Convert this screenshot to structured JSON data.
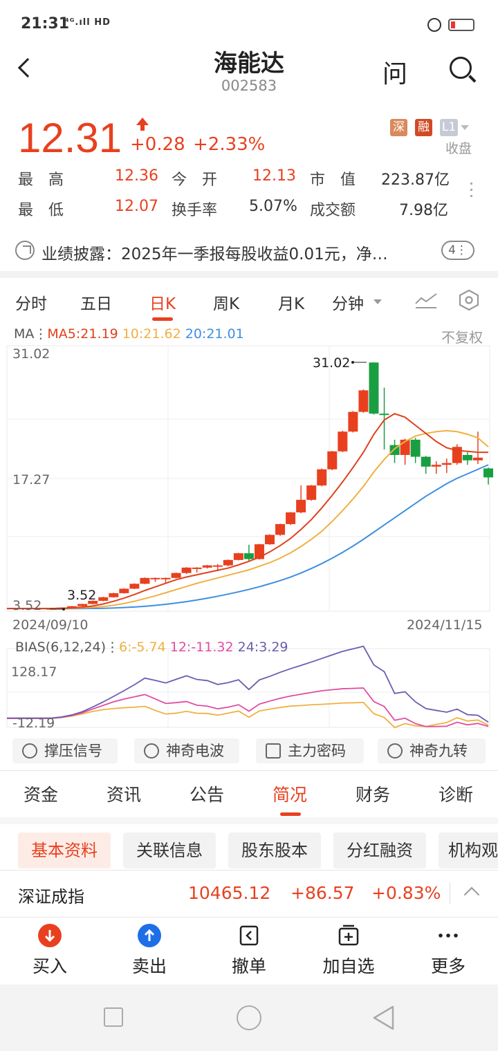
{
  "status": {
    "time": "21:31",
    "signal": "⁴ᴳ.ıll HD"
  },
  "header": {
    "title": "海能达",
    "code": "002583",
    "ask_label": "问"
  },
  "quote": {
    "price": "12.31",
    "change": "+0.28",
    "change_pct": "+2.33%",
    "tags": [
      "深",
      "融",
      "L1"
    ],
    "state": "收盘",
    "rows": [
      [
        {
          "label": "最　高",
          "value": "12.36"
        },
        {
          "label": "今　开",
          "value": "12.13"
        },
        {
          "label": "市　值",
          "value": "223.87亿"
        }
      ],
      [
        {
          "label": "最　低",
          "value": "12.07"
        },
        {
          "label": "换手率",
          "value": "5.07%"
        },
        {
          "label": "成交额",
          "value": "7.98亿"
        }
      ]
    ]
  },
  "notice": {
    "text": "业绩披露：2025年一季报每股收益0.01元，净…",
    "badge": "4⋮"
  },
  "chart_tabs": [
    "分时",
    "五日",
    "日K",
    "周K",
    "月K",
    "分钟"
  ],
  "ma_legend": {
    "prefix": "MA⋮",
    "ma5": "MA5:21.19",
    "ma10": "10:21.62",
    "ma20": "20:21.01",
    "right": "不复权"
  },
  "chart_labels": {
    "y_top": "31.02",
    "y_mid": "17.27",
    "y_bot": "3.52",
    "max_mark": "31.02",
    "min_mark": "3.52",
    "date_left": "2024/09/10",
    "date_right": "2024/11/15"
  },
  "bias_legend": {
    "prefix": "BIAS(6,12,24)⋮",
    "b6": "6:-5.74",
    "b12": "12:-11.32",
    "b24": "24:3.29",
    "y_top": "128.17",
    "y_bot": "-12.19"
  },
  "tools": [
    "撑压信号",
    "神奇电波",
    "主力密码",
    "神奇九转"
  ],
  "bottom_tabs": [
    "资金",
    "资讯",
    "公告",
    "简况",
    "财务",
    "诊断"
  ],
  "sub_tabs": [
    "基本资料",
    "关联信息",
    "股东股本",
    "分红融资",
    "机构观"
  ],
  "index": {
    "name": "深证成指",
    "value": "10465.12",
    "change": "+86.57",
    "pct": "+0.83%"
  },
  "actions": [
    "买入",
    "卖出",
    "撤单",
    "加自选",
    "更多"
  ],
  "colors": {
    "up": "#e8401f",
    "down": "#1a9e42",
    "ma5": "#e0401c",
    "ma10": "#f0b040",
    "ma20": "#3d8fe0",
    "bias6": "#f0b040",
    "bias12": "#e04ca0",
    "bias24": "#6c5cb0"
  },
  "chart_data": {
    "type": "candlestick",
    "y_range": [
      3.52,
      31.02
    ],
    "candles": [
      [
        3.6,
        3.62,
        3.58,
        3.64
      ],
      [
        3.62,
        3.7,
        3.6,
        3.72
      ],
      [
        3.7,
        3.85,
        3.68,
        3.88
      ],
      [
        3.85,
        4.1,
        3.82,
        4.12
      ],
      [
        4.1,
        4.45,
        4.05,
        4.5
      ],
      [
        4.45,
        4.85,
        4.4,
        4.9
      ],
      [
        4.85,
        5.3,
        4.8,
        5.35
      ],
      [
        5.3,
        5.8,
        5.25,
        5.85
      ],
      [
        5.8,
        6.35,
        5.75,
        6.4
      ],
      [
        6.35,
        7.0,
        6.3,
        7.05
      ],
      [
        7.0,
        7.0,
        6.55,
        7.05
      ],
      [
        7.0,
        7.0,
        6.45,
        7.05
      ],
      [
        7.0,
        7.55,
        6.95,
        7.6
      ],
      [
        7.55,
        8.15,
        7.45,
        8.2
      ],
      [
        8.15,
        8.15,
        7.6,
        8.2
      ],
      [
        8.15,
        8.4,
        8.05,
        8.45
      ],
      [
        8.4,
        8.4,
        7.75,
        8.55
      ],
      [
        8.4,
        9.0,
        8.3,
        9.05
      ],
      [
        9.0,
        9.75,
        8.95,
        9.8
      ],
      [
        9.75,
        9.1,
        8.85,
        10.7
      ],
      [
        9.1,
        10.75,
        9.05,
        10.8
      ],
      [
        10.75,
        11.8,
        10.7,
        11.85
      ],
      [
        11.8,
        13.0,
        11.7,
        13.05
      ],
      [
        13.0,
        14.3,
        12.9,
        14.35
      ],
      [
        14.3,
        15.7,
        14.2,
        17.3
      ],
      [
        15.7,
        17.3,
        15.6,
        17.35
      ],
      [
        17.3,
        19.1,
        17.2,
        19.2
      ],
      [
        19.1,
        21.1,
        19.0,
        21.15
      ],
      [
        21.1,
        23.3,
        21.0,
        23.4
      ],
      [
        23.3,
        25.5,
        23.2,
        25.6
      ],
      [
        25.5,
        27.9,
        25.4,
        28.0
      ],
      [
        31.0,
        25.3,
        25.2,
        31.02
      ],
      [
        25.3,
        25.2,
        21.3,
        28.2
      ],
      [
        21.8,
        20.7,
        19.8,
        22.4
      ],
      [
        20.7,
        22.4,
        19.6,
        22.5
      ],
      [
        22.4,
        20.5,
        19.8,
        22.6
      ],
      [
        20.5,
        19.4,
        18.6,
        20.6
      ],
      [
        19.4,
        19.6,
        18.6,
        20.0
      ],
      [
        19.6,
        19.8,
        18.7,
        20.3
      ],
      [
        19.8,
        21.6,
        19.6,
        21.9
      ],
      [
        20.7,
        20.1,
        19.6,
        21.0
      ],
      [
        20.1,
        20.4,
        19.7,
        23.3
      ],
      [
        19.2,
        18.2,
        17.4,
        19.3
      ]
    ],
    "ma5": [
      3.6,
      3.62,
      3.66,
      3.74,
      3.88,
      4.1,
      4.4,
      4.75,
      5.15,
      5.6,
      6.0,
      6.4,
      6.8,
      7.1,
      7.35,
      7.6,
      7.85,
      8.1,
      8.45,
      8.85,
      9.3,
      9.9,
      10.6,
      11.4,
      12.4,
      13.5,
      14.8,
      16.2,
      17.7,
      19.3,
      21.0,
      23.0,
      24.6,
      25.3,
      24.9,
      24.0,
      23.1,
      22.2,
      21.5,
      21.2,
      21.1,
      21.0,
      21.0
    ],
    "ma10": [
      3.6,
      3.6,
      3.62,
      3.66,
      3.72,
      3.82,
      3.95,
      4.15,
      4.4,
      4.7,
      5.0,
      5.35,
      5.7,
      6.05,
      6.4,
      6.7,
      7.0,
      7.3,
      7.6,
      7.9,
      8.3,
      8.7,
      9.2,
      9.8,
      10.5,
      11.3,
      12.2,
      13.3,
      14.5,
      15.8,
      17.2,
      18.8,
      20.2,
      21.4,
      22.2,
      22.8,
      23.1,
      23.3,
      23.4,
      23.3,
      23.0,
      22.6,
      21.6
    ],
    "ma20": [
      3.58,
      3.58,
      3.58,
      3.59,
      3.6,
      3.62,
      3.65,
      3.7,
      3.76,
      3.84,
      3.94,
      4.06,
      4.2,
      4.36,
      4.54,
      4.74,
      4.96,
      5.2,
      5.45,
      5.72,
      6.02,
      6.35,
      6.7,
      7.1,
      7.55,
      8.05,
      8.6,
      9.2,
      9.85,
      10.55,
      11.3,
      12.1,
      12.9,
      13.7,
      14.5,
      15.3,
      16.1,
      16.8,
      17.5,
      18.1,
      18.6,
      19.1,
      19.6
    ]
  }
}
